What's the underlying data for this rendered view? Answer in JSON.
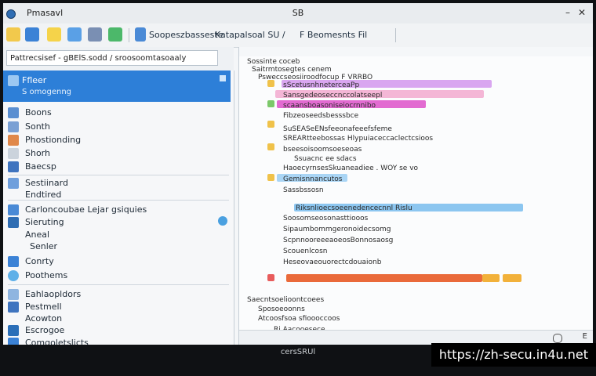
{
  "window": {
    "title_left": "Pmasavl",
    "title_center": "SB"
  },
  "toolbar": {
    "labels": [
      "Soopeszbasseste",
      "Katapalsoal SU /",
      "F Beomesnts Fil"
    ]
  },
  "address": {
    "value": "Pattrecsisef - gBElS.sodd / sroosoomtasoaaly"
  },
  "sidebar": {
    "selected": {
      "label": "Ffleer",
      "sub": "S omogenng"
    },
    "items": [
      {
        "label": "Boons"
      },
      {
        "label": "Sonth"
      },
      {
        "label": "Phostionding"
      },
      {
        "label": "Shorh"
      },
      {
        "label": "Baecsp"
      },
      {
        "label": "Sestiinard"
      },
      {
        "label": "Endtired"
      },
      {
        "label": "Carloncoubae Lejar gsiquies"
      },
      {
        "label": "Sieruting"
      },
      {
        "label": "Aneal"
      },
      {
        "label": "Senler"
      },
      {
        "label": "Conrty"
      },
      {
        "label": "Poothems"
      },
      {
        "label": "Eahlaopldors"
      },
      {
        "label": "Pestmell"
      },
      {
        "label": "Acowton"
      },
      {
        "label": "Escrogoe"
      },
      {
        "label": "Comgoletslicts"
      }
    ]
  },
  "editor": {
    "lines": [
      "Sossinte coceb",
      "Saitrmtosegtes cenem",
      "Psweccseosiiroodfocup F VRRBO",
      "sScetusnhneterceaPp",
      "Sansgedeoseccnccolatseepl",
      "scaansboasoniseiocrnnibo",
      "Fibzeoseedsbesssbce",
      "SuSEASeENsfeeonafeeefsfeme",
      "SREARtteebossas Hlypuiaceccaclectcsioos",
      "bseesoisoomsoeseoas",
      "Ssuacnc ee sdacs",
      "HaoecyrnsesSkuaneadiee . WOY se vo",
      "Gemisnnancutos",
      "Sassbssosn",
      "Riksnlioecsoeenedencecnnl Rislu",
      "Soosomseosonasttiooos",
      "Sipaumbommgeronoidecsomg",
      "ScpnnooreeeaoeosBonnosaosg",
      "Scouenlcosn",
      "Heseovaeouorectcdouaionb",
      "Saecntsoelioontcoees",
      "Sposoeoonns",
      "Atcoosfsoa sfioooccoos",
      "Ri Aacooesece"
    ],
    "status_right": "E"
  },
  "bezel": {
    "brand": "cersSRUl"
  },
  "watermark": "https://zh-secu.in4u.net"
}
